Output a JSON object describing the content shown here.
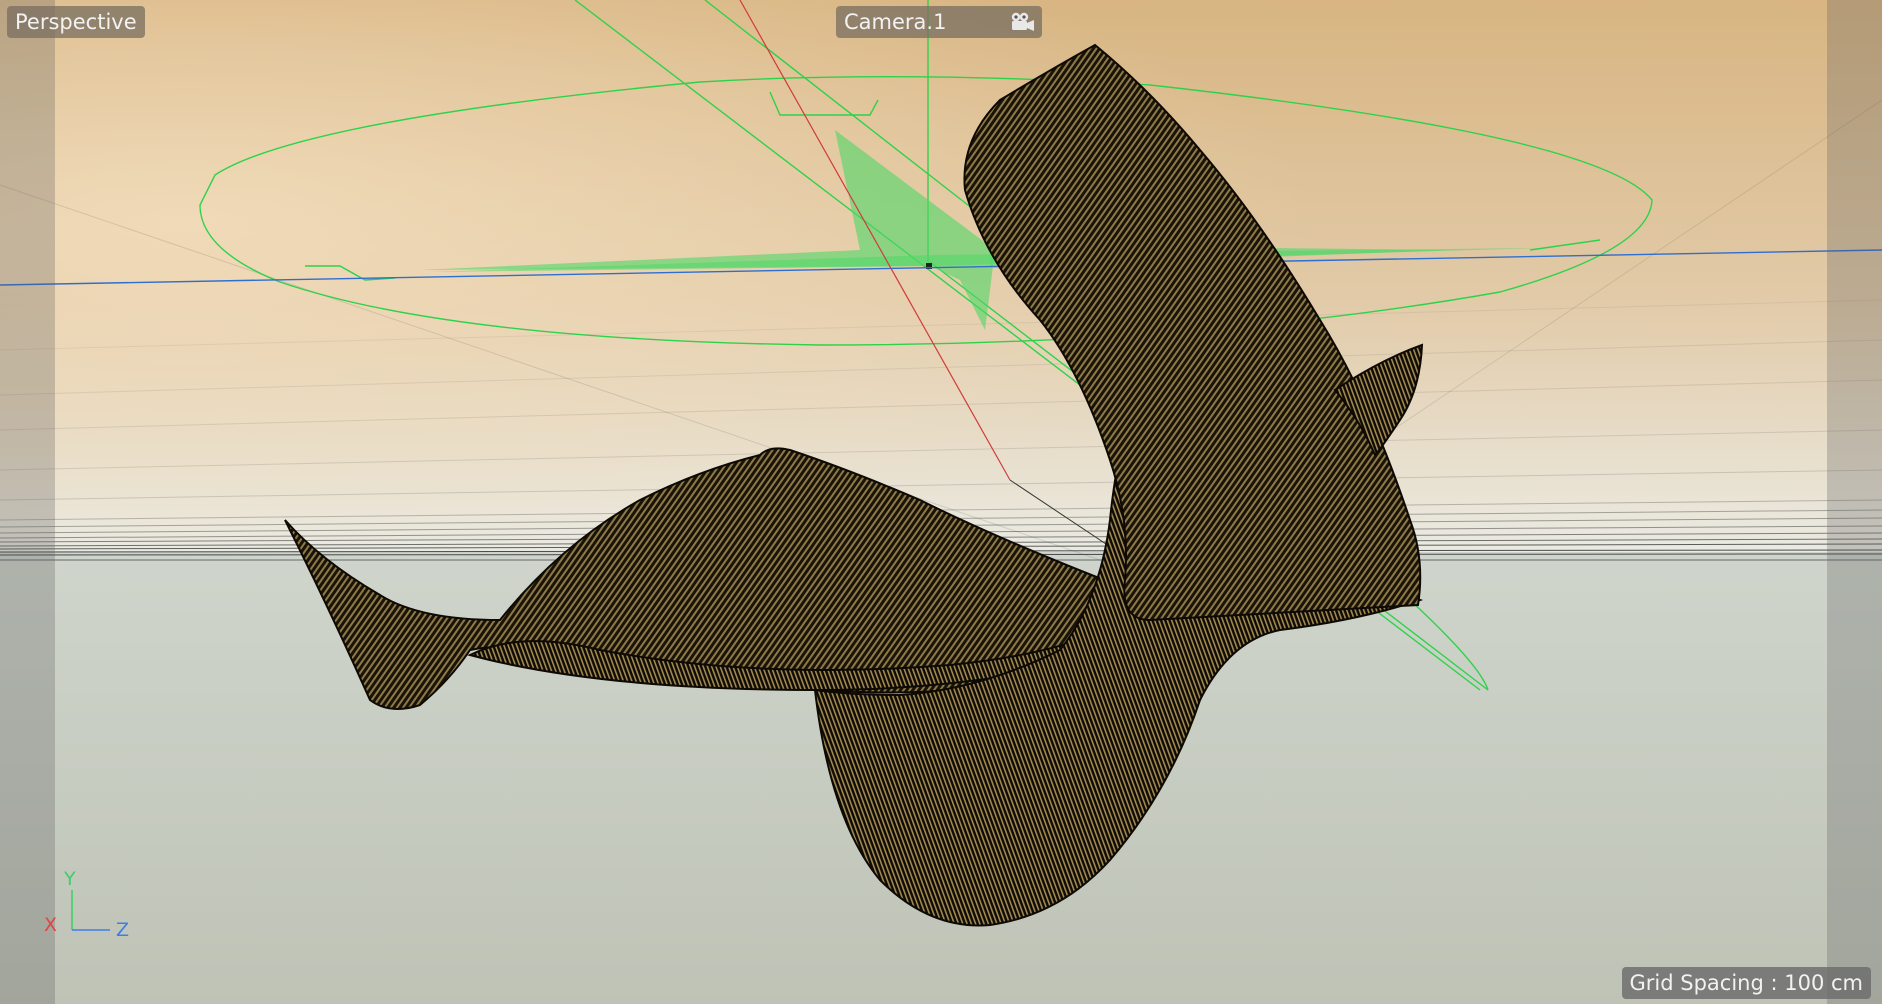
{
  "viewport": {
    "view_name": "Perspective",
    "camera_name": "Camera.1",
    "camera_icon": "camera-icon",
    "grid_spacing_label": "Grid Spacing : 100 cm"
  },
  "axis_gizmo": {
    "y_label": "Y",
    "x_label": "X",
    "z_label": "Z"
  },
  "colors": {
    "sky_top": "#d9b784",
    "sky_horizon": "#ecebe1",
    "floor": "#c6ccc0",
    "camera_gizmo": "#2ed24a",
    "mesh_dark": "#120d05",
    "mesh_light": "#8a7440",
    "axis_x": "#e04545",
    "axis_y": "#3ccf6a",
    "axis_z": "#3d7fe6"
  }
}
